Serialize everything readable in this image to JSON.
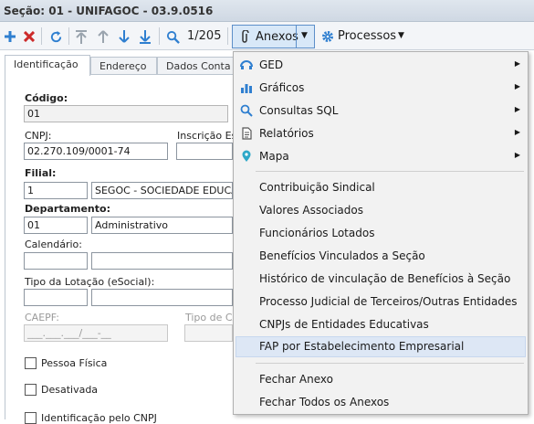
{
  "window": {
    "title": "Seção: 01 - UNIFAGOC - 03.9.0516"
  },
  "toolbar": {
    "record_counter": "1/205",
    "anexos_label": "Anexos",
    "processos_label": "Processos",
    "dropdown_arrow": "▼"
  },
  "tabs": [
    {
      "label": "Identificação"
    },
    {
      "label": "Endereço"
    },
    {
      "label": "Dados Conta"
    }
  ],
  "form": {
    "codigo_label": "Código:",
    "codigo_value": "01",
    "cnpj_label": "CNPJ:",
    "cnpj_value": "02.270.109/0001-74",
    "inscricao_label": "Inscrição Est",
    "filial_label": "Filial:",
    "filial_code": "1",
    "filial_name": "SEGOC - SOCIEDADE EDUCACI",
    "departamento_label": "Departamento:",
    "departamento_code": "01",
    "departamento_name": "Administrativo",
    "calendario_label": "Calendário:",
    "tipo_lotacao_label": "Tipo da Lotação (eSocial):",
    "caepf_label": "CAEPF:",
    "caepf_value": "___.___.___/___-__",
    "tipo_ca_label": "Tipo de CA",
    "pessoa_fisica_label": "Pessoa Física",
    "desativada_label": "Desativada",
    "identificacao_cnpj_label": "Identificação pelo CNPJ"
  },
  "menu": {
    "items_top": [
      {
        "label": "GED",
        "icon": "ged-icon",
        "submenu": true
      },
      {
        "label": "Gráficos",
        "icon": "chart-icon",
        "submenu": true
      },
      {
        "label": "Consultas SQL",
        "icon": "search-icon",
        "submenu": true
      },
      {
        "label": "Relatórios",
        "icon": "report-icon",
        "submenu": true
      },
      {
        "label": "Mapa",
        "icon": "map-pin-icon",
        "submenu": true
      }
    ],
    "items_mid": [
      {
        "label": "Contribuição Sindical"
      },
      {
        "label": "Valores Associados"
      },
      {
        "label": "Funcionários Lotados"
      },
      {
        "label": "Benefícios Vinculados a Seção"
      },
      {
        "label": "Histórico de vinculação de Benefícios à Seção"
      },
      {
        "label": "Processo Judicial de Terceiros/Outras Entidades"
      },
      {
        "label": "CNPJs de Entidades Educativas"
      },
      {
        "label": "FAP por Estabelecimento Empresarial"
      }
    ],
    "items_bottom": [
      {
        "label": "Fechar Anexo"
      },
      {
        "label": "Fechar Todos os Anexos"
      }
    ],
    "submenu_arrow": "▶",
    "highlight_color": "#dde7f5"
  },
  "colors": {
    "accent": "#2f7fd0",
    "delete": "#cc2a2a"
  }
}
